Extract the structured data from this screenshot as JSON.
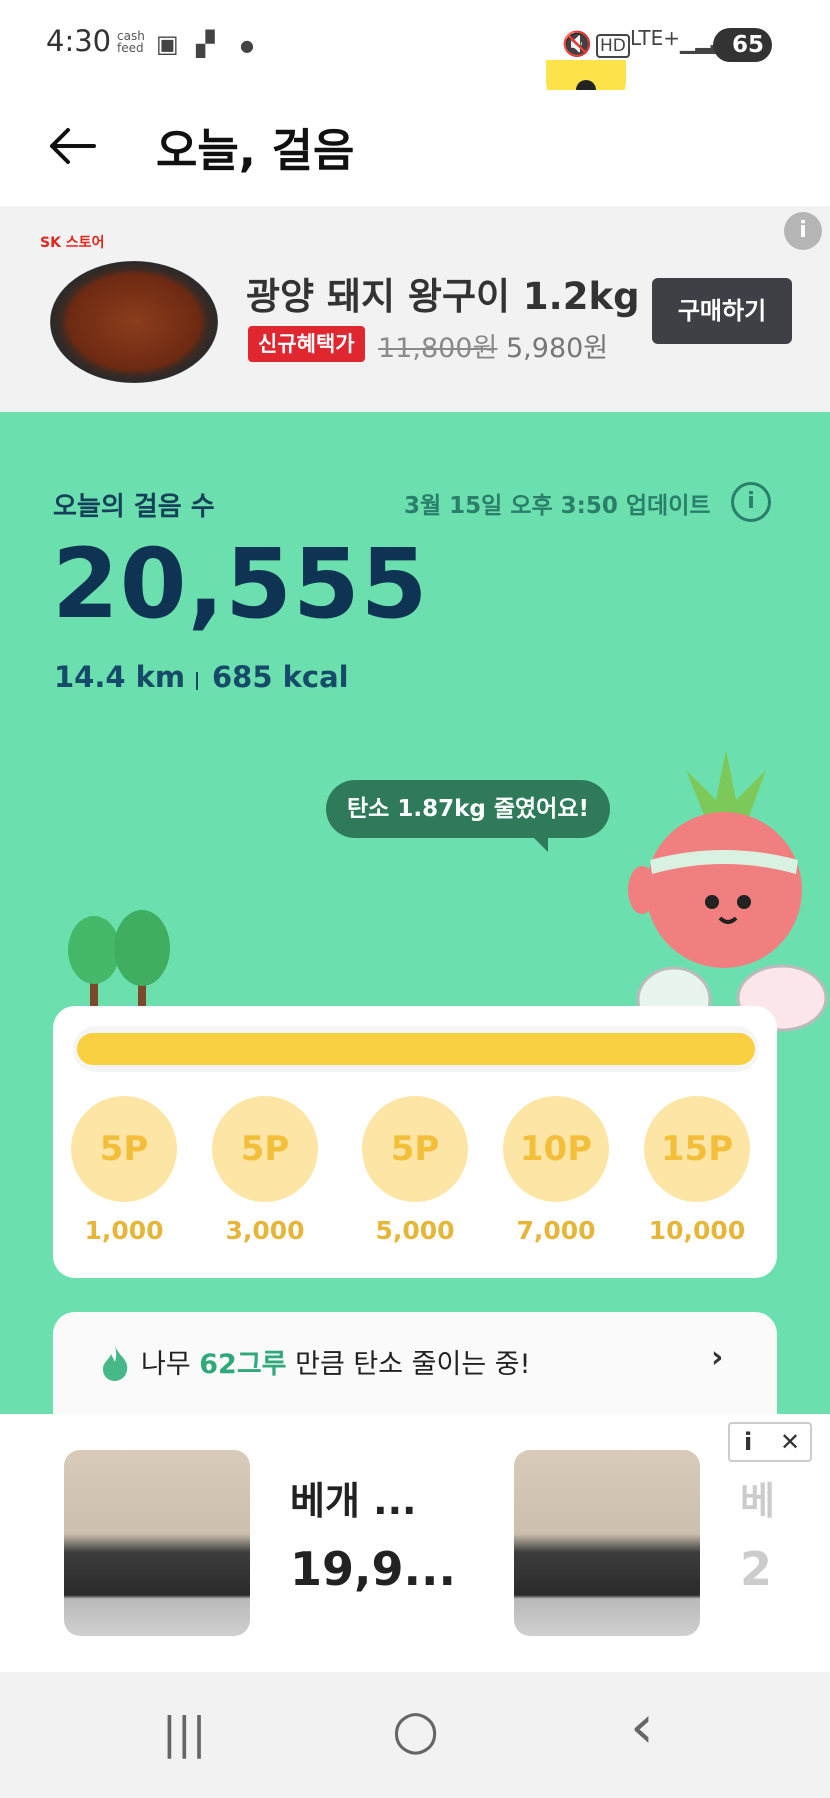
{
  "status_bar": {
    "time": "4:30",
    "app_label": "cash feed",
    "network": "LTE+",
    "hd": "HD",
    "battery": "65"
  },
  "header": {
    "title": "오늘, 걸음"
  },
  "top_ad": {
    "brand": "SK 스토어",
    "product_name": "광양 돼지 왕구이 1.2kg",
    "badge": "신규혜택가",
    "original_price": "11,800원",
    "sale_price": "5,980원",
    "buy_label": "구매하기",
    "info": "i"
  },
  "steps": {
    "label": "오늘의 걸음 수",
    "updated": "3월 15일 오후 3:50 업데이트",
    "info": "i",
    "count": "20,555",
    "distance": "14.4 km",
    "calories": "685 kcal",
    "carbon_bubble": "탄소 1.87kg 줄였어요!",
    "progress": 1.0
  },
  "rewards": [
    {
      "points": "5P",
      "goal": "1,000"
    },
    {
      "points": "5P",
      "goal": "3,000"
    },
    {
      "points": "5P",
      "goal": "5,000"
    },
    {
      "points": "10P",
      "goal": "7,000"
    },
    {
      "points": "15P",
      "goal": "10,000"
    }
  ],
  "tree_banner": {
    "prefix": "나무 ",
    "highlight": "62그루",
    "suffix": " 만큼 탄소 줄이는 중!",
    "chevron": "›"
  },
  "bottom_ad": {
    "product_name": "베개 ...",
    "price": "19,9...",
    "partial_name": "베",
    "partial_price": "2",
    "info": "i",
    "close": "✕"
  },
  "nav": {
    "recent": "|||",
    "home": "○",
    "back": "‹"
  },
  "colors": {
    "green_bg": "#6be0ae",
    "progress_fill": "#f7cf3f",
    "coin": "#fde6a5",
    "badge_red": "#e0262f",
    "dark_navy": "#0f3352"
  }
}
